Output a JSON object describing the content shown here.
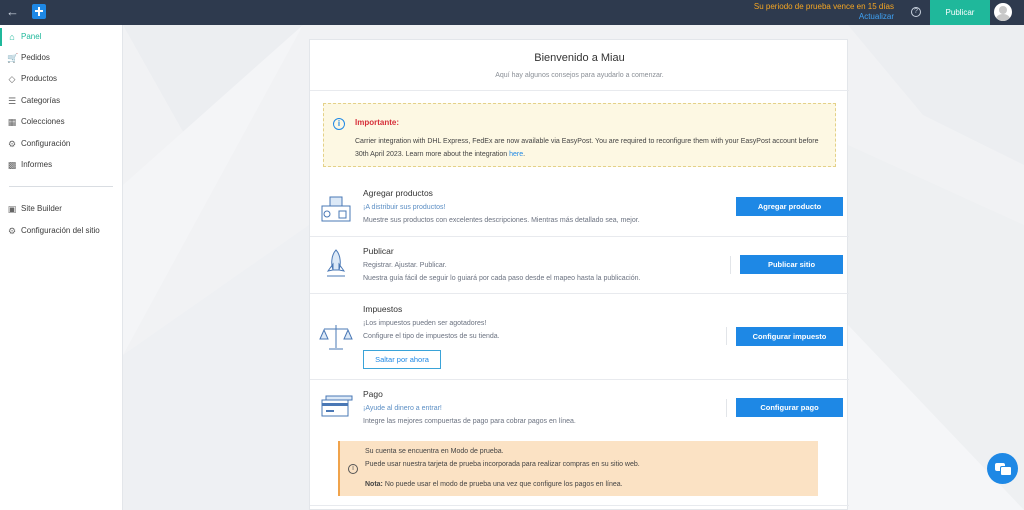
{
  "topbar": {
    "trial_message": "Su periodo de prueba vence en 15 días",
    "update_link": "Actualizar",
    "help_glyph": "?",
    "publish_label": "Publicar"
  },
  "sidebar": {
    "items": [
      {
        "label": "Panel",
        "icon": "home-icon"
      },
      {
        "label": "Pedidos",
        "icon": "cart-icon"
      },
      {
        "label": "Productos",
        "icon": "tag-icon"
      },
      {
        "label": "Categorías",
        "icon": "layers-icon"
      },
      {
        "label": "Colecciones",
        "icon": "grid-icon"
      },
      {
        "label": "Configuración",
        "icon": "gear-icon"
      },
      {
        "label": "Informes",
        "icon": "chart-icon"
      },
      {
        "label": "Site Builder",
        "icon": "builder-icon"
      },
      {
        "label": "Configuración del sitio",
        "icon": "gear-icon"
      }
    ]
  },
  "main": {
    "title": "Bienvenido a Miau",
    "subtitle": "Aquí hay algunos consejos para ayudarlo a comenzar.",
    "notice": {
      "title": "Importante:",
      "body": "Carrier integration with DHL Express, FedEx are now available via EasyPost. You are required to reconfigure them with your EasyPost account before 30th April 2023. Learn more about the integration ",
      "link": "here",
      "end": "."
    },
    "steps": [
      {
        "title": "Agregar productos",
        "line1": "¡A distribuir sus productos!",
        "line2": "Muestre sus productos con excelentes descripciones. Mientras más detallado sea, mejor.",
        "button": "Agregar producto"
      },
      {
        "title": "Publicar",
        "line1": "Registrar. Ajustar. Publicar.",
        "line2": "Nuestra guía fácil de seguir lo guiará por cada paso desde el mapeo hasta la publicación.",
        "button": "Publicar sitio"
      },
      {
        "title": "Impuestos",
        "line1": "¡Los impuestos pueden ser agotadores!",
        "line2": "Configure el tipo de impuestos de su tienda.",
        "button": "Configurar impuesto",
        "secondary": "Saltar por ahora"
      },
      {
        "title": "Pago",
        "line1": "¡Ayude al dinero a entrar!",
        "line2": "Integre las mejores compuertas de pago para cobrar pagos en línea.",
        "button": "Configurar pago"
      }
    ],
    "test_mode": {
      "line1": "Su cuenta se encuentra en Modo de prueba.",
      "line2": "Puede usar nuestra tarjeta de prueba incorporada para realizar compras en su sitio web.",
      "note_label": "Nota:",
      "note_text": " No puede usar el modo de prueba una vez que configure los pagos en línea."
    }
  },
  "colors": {
    "topbar": "#2e3a4e",
    "accent": "#1fb89b",
    "primary_button": "#1e88e5",
    "trial_text": "#f5a623",
    "notice_bg": "#fdf8e3",
    "test_bg": "#fbe2c4"
  }
}
